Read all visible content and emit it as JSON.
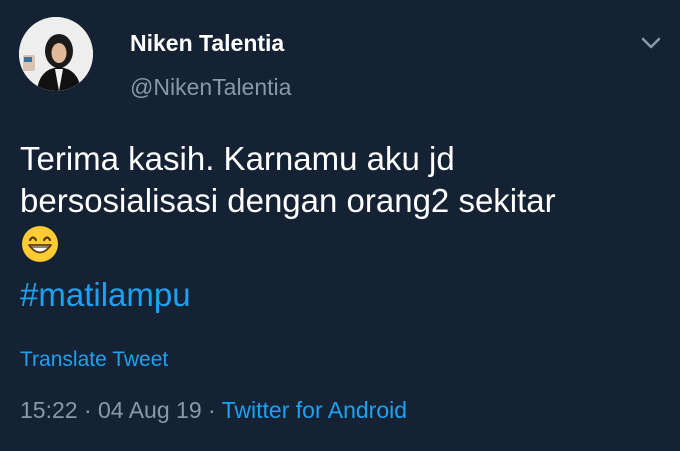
{
  "author": {
    "display_name": "Niken Talentia",
    "handle": "@NikenTalentia",
    "avatar_icon": "profile-photo"
  },
  "tweet": {
    "line1": "Terima kasih. Karnamu aku jd",
    "line2": "bersosialisasi dengan orang2 sekitar",
    "emoji": "grinning-face-with-smiling-eyes",
    "hashtag": "#matilampu"
  },
  "translate_label": "Translate Tweet",
  "meta": {
    "time": "15:22",
    "separator": " · ",
    "date": "04 Aug 19",
    "source": "Twitter for Android"
  },
  "colors": {
    "background": "#152234",
    "accent": "#1da1f2",
    "secondary_text": "#8899a6",
    "primary_text": "#ffffff"
  }
}
